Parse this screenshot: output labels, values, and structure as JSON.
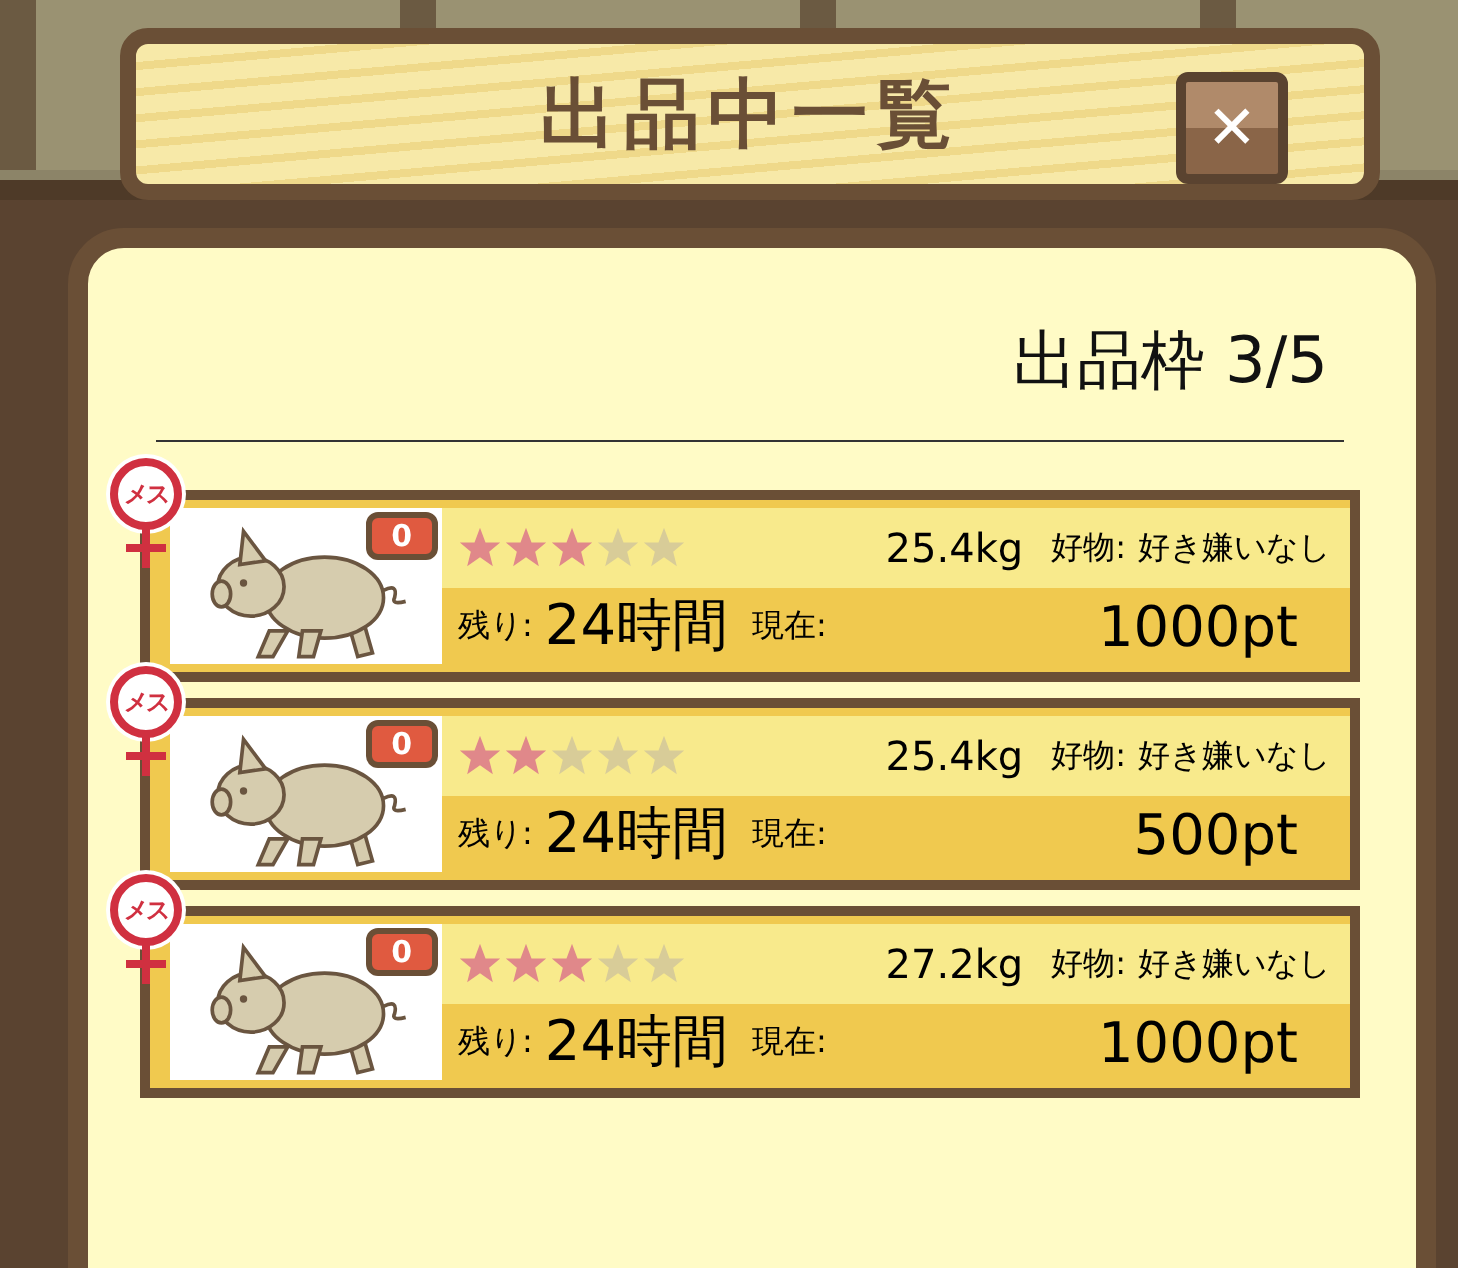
{
  "window": {
    "title": "出品中一覧",
    "close": "✕"
  },
  "slots": {
    "label": "出品枠 3/5"
  },
  "listings": [
    {
      "gender": "メス",
      "badge": "0",
      "stars": 3,
      "weight": "25.4kg",
      "likes_label": "好物:",
      "likes": "好き嫌いなし",
      "remaining_label": "残り:",
      "remaining": "24時間",
      "current_label": "現在:",
      "price": "1000pt"
    },
    {
      "gender": "メス",
      "badge": "0",
      "stars": 2,
      "weight": "25.4kg",
      "likes_label": "好物:",
      "likes": "好き嫌いなし",
      "remaining_label": "残り:",
      "remaining": "24時間",
      "current_label": "現在:",
      "price": "500pt"
    },
    {
      "gender": "メス",
      "badge": "0",
      "stars": 3,
      "weight": "27.2kg",
      "likes_label": "好物:",
      "likes": "好き嫌いなし",
      "remaining_label": "残り:",
      "remaining": "24時間",
      "current_label": "現在:",
      "price": "1000pt"
    }
  ]
}
